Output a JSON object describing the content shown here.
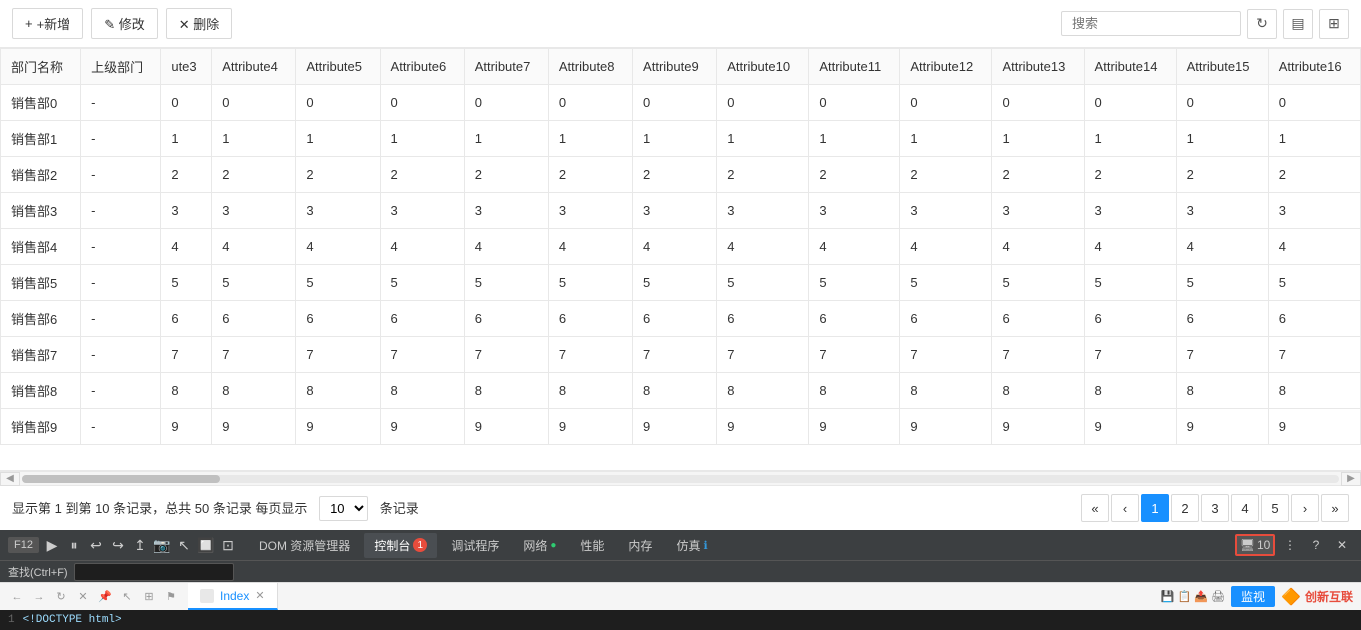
{
  "toolbar": {
    "add_label": "+新增",
    "edit_label": "✎ 修改",
    "delete_label": "✕ 删除",
    "search_placeholder": "搜索"
  },
  "table": {
    "columns": [
      "部门名称",
      "上级部门",
      "ute3",
      "Attribute4",
      "Attribute5",
      "Attribute6",
      "Attribute7",
      "Attribute8",
      "Attribute9",
      "Attribute10",
      "Attribute11",
      "Attribute12",
      "Attribute13",
      "Attribute14",
      "Attribute15",
      "Attribute16"
    ],
    "rows": [
      {
        "name": "销售部0",
        "parent": "-",
        "vals": [
          0,
          0,
          0,
          0,
          0,
          0,
          0,
          0,
          0,
          0,
          0,
          0,
          0,
          0
        ]
      },
      {
        "name": "销售部1",
        "parent": "-",
        "vals": [
          1,
          1,
          1,
          1,
          1,
          1,
          1,
          1,
          1,
          1,
          1,
          1,
          1,
          1
        ]
      },
      {
        "name": "销售部2",
        "parent": "-",
        "vals": [
          2,
          2,
          2,
          2,
          2,
          2,
          2,
          2,
          2,
          2,
          2,
          2,
          2,
          2
        ]
      },
      {
        "name": "销售部3",
        "parent": "-",
        "vals": [
          3,
          3,
          3,
          3,
          3,
          3,
          3,
          3,
          3,
          3,
          3,
          3,
          3,
          3
        ]
      },
      {
        "name": "销售部4",
        "parent": "-",
        "vals": [
          4,
          4,
          4,
          4,
          4,
          4,
          4,
          4,
          4,
          4,
          4,
          4,
          4,
          4
        ]
      },
      {
        "name": "销售部5",
        "parent": "-",
        "vals": [
          5,
          5,
          5,
          5,
          5,
          5,
          5,
          5,
          5,
          5,
          5,
          5,
          5,
          5
        ]
      },
      {
        "name": "销售部6",
        "parent": "-",
        "vals": [
          6,
          6,
          6,
          6,
          6,
          6,
          6,
          6,
          6,
          6,
          6,
          6,
          6,
          6
        ]
      },
      {
        "name": "销售部7",
        "parent": "-",
        "vals": [
          7,
          7,
          7,
          7,
          7,
          7,
          7,
          7,
          7,
          7,
          7,
          7,
          7,
          7
        ]
      },
      {
        "name": "销售部8",
        "parent": "-",
        "vals": [
          8,
          8,
          8,
          8,
          8,
          8,
          8,
          8,
          8,
          8,
          8,
          8,
          8,
          8
        ]
      },
      {
        "name": "销售部9",
        "parent": "-",
        "vals": [
          9,
          9,
          9,
          9,
          9,
          9,
          9,
          9,
          9,
          9,
          9,
          9,
          9,
          9
        ]
      }
    ]
  },
  "footer": {
    "display_text": "显示第 1 到第 10 条记录，总共 50 条记录 每页显示",
    "page_size": "10",
    "per_page_label": "条记录",
    "pages": [
      "1",
      "2",
      "3",
      "4",
      "5"
    ],
    "current_page": "1"
  },
  "devtools": {
    "f12_label": "F12",
    "tabs": [
      {
        "id": "dom",
        "label": "DOM 资源管理器"
      },
      {
        "id": "console",
        "label": "控制台",
        "badge": "1"
      },
      {
        "id": "debugger",
        "label": "调试程序"
      },
      {
        "id": "network",
        "label": "网络",
        "dot": true
      },
      {
        "id": "perf",
        "label": "性能"
      },
      {
        "id": "memory",
        "label": "内存"
      },
      {
        "id": "emulation",
        "label": "仿真",
        "info": true
      }
    ],
    "right_controls": {
      "screen_label": "10",
      "find_label": "查找(Ctrl+F)"
    }
  },
  "bottom_bar": {
    "tab_label": "Index",
    "monitor_label": "监视",
    "brand": "创新互联"
  },
  "code_line": {
    "line_num": "1",
    "code": "<!DOCTYPE html>"
  }
}
